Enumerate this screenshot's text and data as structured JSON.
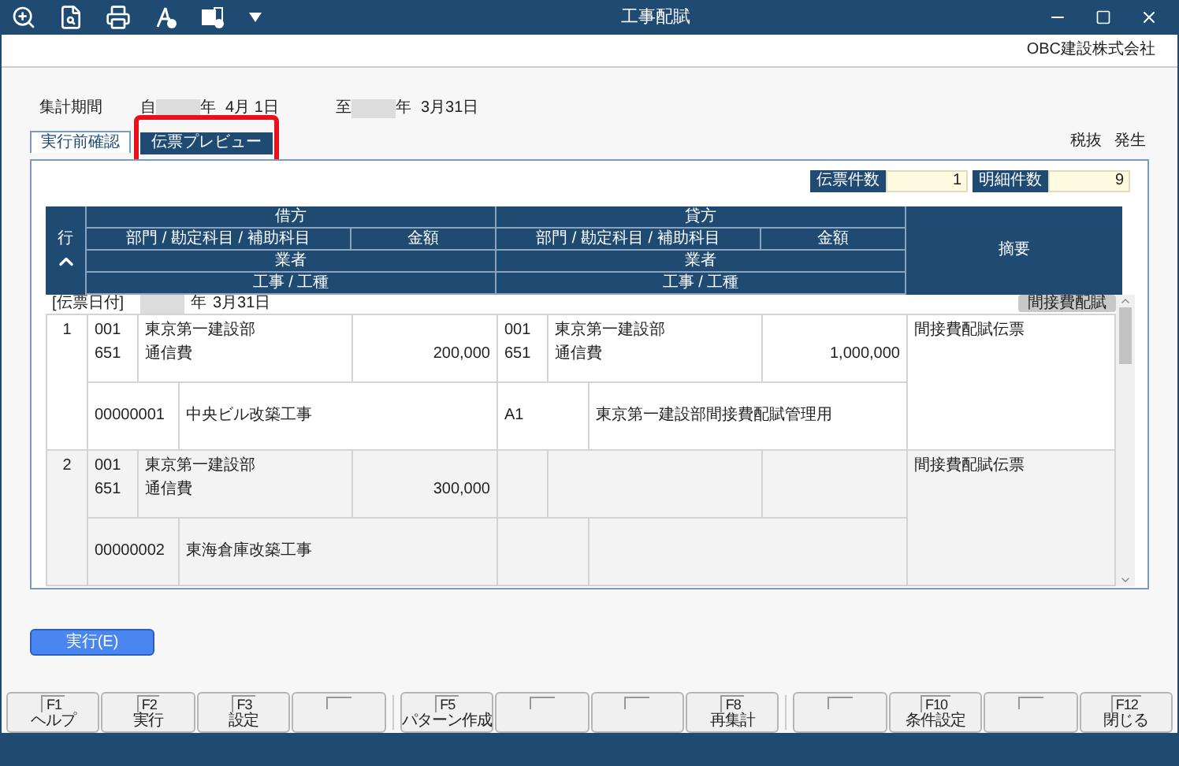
{
  "window": {
    "title": "工事配賦",
    "company": "OBC建設株式会社"
  },
  "period": {
    "label": "集計期間",
    "from_prefix": "自",
    "from_year_suffix": "年",
    "from_date": "4月 1日",
    "to_prefix": "至",
    "to_year_suffix": "年",
    "to_date": "3月31日"
  },
  "tabs": [
    {
      "label": "実行前確認",
      "selected": false,
      "highlighted": false
    },
    {
      "label": "伝票プレビュー",
      "selected": true,
      "highlighted": true
    }
  ],
  "tax_mode": [
    "税抜",
    "発生"
  ],
  "counts": [
    {
      "label": "伝票件数",
      "value": "1"
    },
    {
      "label": "明細件数",
      "value": "9"
    }
  ],
  "table": {
    "row_header": "行",
    "sides": [
      {
        "title": "借方",
        "dept_account": "部門 / 勘定科目 / 補助科目",
        "amount": "金額",
        "vendor": "業者",
        "project": "工事 / 工種"
      },
      {
        "title": "貸方",
        "dept_account": "部門 / 勘定科目 / 補助科目",
        "amount": "金額",
        "vendor": "業者",
        "project": "工事 / 工種"
      }
    ],
    "memo": "摘要",
    "date_label": "[伝票日付]",
    "date_year_suffix": "年",
    "date": "3月31日",
    "voucher_type": "間接費配賦",
    "rows": [
      {
        "no": "1",
        "debit": {
          "codes": [
            "001",
            "651"
          ],
          "names": [
            "東京第一建設部",
            "通信費"
          ],
          "amount": "200,000",
          "project_code": "00000001",
          "project_name": "中央ビル改築工事"
        },
        "credit": {
          "codes": [
            "001",
            "651"
          ],
          "names": [
            "東京第一建設部",
            "通信費"
          ],
          "amount": "1,000,000",
          "project_code": "A1",
          "project_name": "東京第一建設部間接費配賦管理用"
        },
        "memo": "間接費配賦伝票"
      },
      {
        "no": "2",
        "debit": {
          "codes": [
            "001",
            "651"
          ],
          "names": [
            "東京第一建設部",
            "通信費"
          ],
          "amount": "300,000",
          "project_code": "00000002",
          "project_name": "東海倉庫改築工事"
        },
        "credit": {},
        "memo": "間接費配賦伝票"
      }
    ]
  },
  "execute_button": "実行(E)",
  "function_keys": [
    {
      "kind": "assigned",
      "key": "F1",
      "label": "ヘルプ"
    },
    {
      "kind": "assigned",
      "key": "F2",
      "label": "実行"
    },
    {
      "kind": "assigned",
      "key": "F3",
      "label": "設定"
    },
    {
      "kind": "blank"
    },
    {
      "kind": "assigned",
      "key": "F5",
      "label": "パターン作成"
    },
    {
      "kind": "blank"
    },
    {
      "kind": "blank"
    },
    {
      "kind": "assigned",
      "key": "F8",
      "label": "再集計"
    },
    {
      "kind": "blank"
    },
    {
      "kind": "assigned",
      "key": "F10",
      "label": "条件設定"
    },
    {
      "kind": "blank"
    },
    {
      "kind": "assigned",
      "key": "F12",
      "label": "閉じる"
    }
  ]
}
